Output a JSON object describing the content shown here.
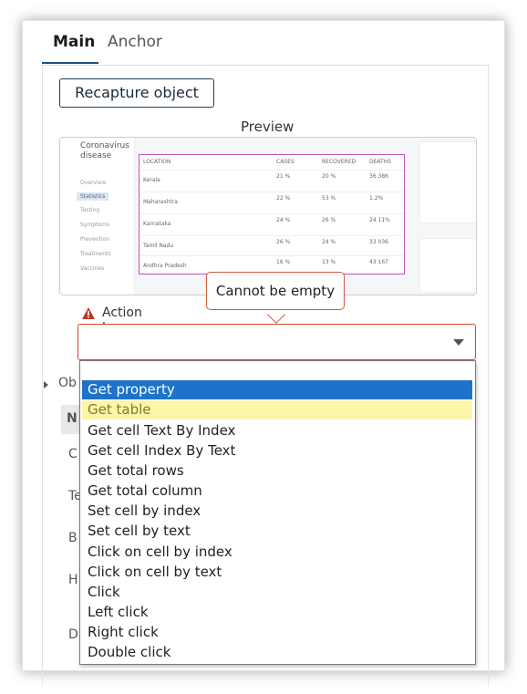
{
  "tabs": [
    {
      "label": "Main",
      "active": true
    },
    {
      "label": "Anchor",
      "active": false
    }
  ],
  "recapture_label": "Recapture object",
  "preview": {
    "label": "Preview",
    "thumb_title": "Coronavirus disease",
    "thumb_nav": [
      "Overview",
      "Statistics",
      "Testing",
      "Symptoms",
      "Prevention",
      "Treatments",
      "Vaccines"
    ],
    "thumb_heads": [
      "LOCATION",
      "CASES",
      "RECOVERED",
      "DEATHS"
    ],
    "thumb_rows": [
      [
        "Kerala",
        "21 %",
        "20 %",
        "36 386"
      ],
      [
        "Maharashtra",
        "22 %",
        "53 %",
        "1.2%"
      ],
      [
        "Karnataka",
        "24 %",
        "26 %",
        "24 11%"
      ],
      [
        "Tamil Nadu",
        "26 %",
        "24 %",
        "33 036"
      ],
      [
        "Andhra Pradesh",
        "16 %",
        "13 %",
        "43 167"
      ]
    ]
  },
  "tooltip": "Cannot be empty",
  "action_label": "Action to take on object",
  "select_value": "",
  "background_items": {
    "ob": "Ob",
    "n": "N",
    "c": "C",
    "t": "Te",
    "b": "B",
    "h": "H",
    "d": "D"
  },
  "dropdown_options": [
    "Get property",
    "Get table",
    "Get cell Text By Index",
    "Get cell Index By Text",
    "Get total rows",
    "Get total column",
    "Set cell by index",
    "Set cell by text",
    "Click on cell by index",
    "Click on cell by text",
    "Click",
    "Left click",
    "Right click",
    "Double click"
  ],
  "selected_option": "Get property",
  "hover_option": "Get table",
  "colors": {
    "selected": "#1d73c8",
    "hover": "#fbf6a9",
    "error": "#cf4b2c",
    "preview_highlight": "#c04fc0"
  }
}
